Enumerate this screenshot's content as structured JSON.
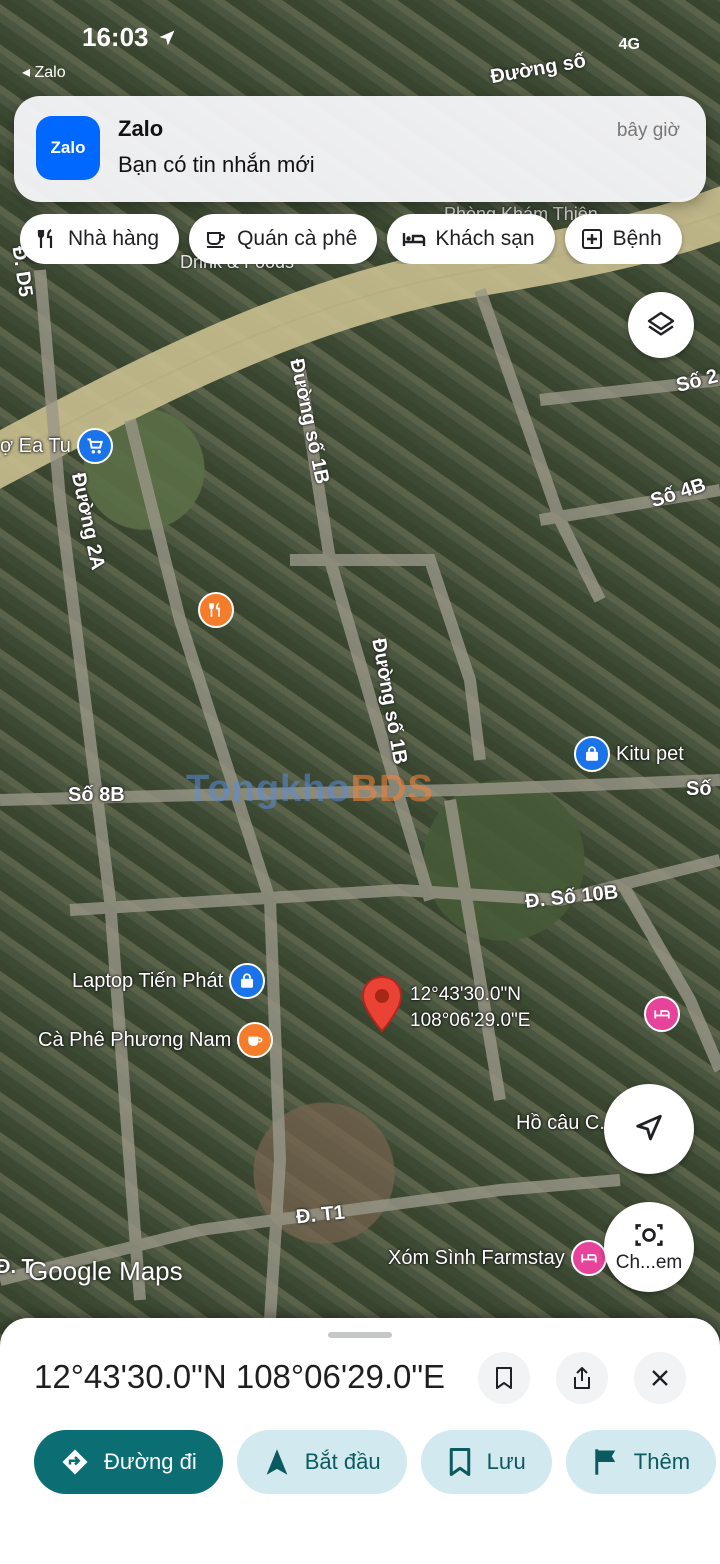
{
  "status_bar": {
    "time": "16:03",
    "back_app": "◂ Zalo",
    "network": "4G"
  },
  "notification": {
    "app_icon_text": "Zalo",
    "app_name": "Zalo",
    "time": "bây giờ",
    "message": "Bạn có tin nhắn mới"
  },
  "chips": [
    {
      "label": "Nhà hàng",
      "icon": "restaurant-icon"
    },
    {
      "label": "Quán cà phê",
      "icon": "coffee-icon"
    },
    {
      "label": "Khách sạn",
      "icon": "hotel-icon"
    },
    {
      "label": "Bệnh",
      "icon": "hospital-icon"
    }
  ],
  "map": {
    "road_labels": [
      "Đường số 1B",
      "Đường số 1B",
      "Đường 2A",
      "Số 8B",
      "Đ. Số 10B",
      "Số 4B",
      "Số 2",
      "Đ. T1",
      "Đ. D5",
      "Đường số",
      "Số",
      "Đ. T"
    ],
    "faint_labels": [
      "Drink & Foods",
      "Phòng Khám Thiện"
    ],
    "pois": [
      {
        "label": "ợ Ea Tu",
        "icon": "shopping-cart-icon",
        "color": "#1a73e8"
      },
      {
        "label": "Kitu pet",
        "icon": "shopping-bag-icon",
        "color": "#1a73e8"
      },
      {
        "label": "Laptop Tiến Phát",
        "icon": "shopping-bag-icon",
        "color": "#1a73e8"
      },
      {
        "label": "Cà Phê Phương Nam",
        "icon": "coffee-icon",
        "color": "#f57c2b"
      },
      {
        "label": "Hồ câu C...ến",
        "icon": "pin-icon",
        "color": "#1a73e8"
      },
      {
        "label": "Xóm Sình Farmstay",
        "icon": "hotel-icon",
        "color": "#e8439a"
      },
      {
        "label": "",
        "icon": "restaurant-icon",
        "color": "#f57c2b"
      },
      {
        "label": "",
        "icon": "hotel-icon",
        "color": "#e8439a"
      }
    ],
    "pin_coords": {
      "lat": "12°43'30.0\"N",
      "lng": "108°06'29.0\"E"
    },
    "watermark": {
      "part1": "Tongkho",
      "part2": "BDS"
    },
    "google_logo": "Google Maps"
  },
  "fabs": {
    "lens_label": "Ch...em"
  },
  "sheet": {
    "title": "12°43'30.0\"N 108°06'29.0\"E",
    "actions": [
      {
        "label": "Đường đi",
        "icon": "directions-icon"
      },
      {
        "label": "Bắt đầu",
        "icon": "navigation-arrow-icon"
      },
      {
        "label": "Lưu",
        "icon": "bookmark-icon"
      },
      {
        "label": "Thêm",
        "icon": "flag-icon"
      }
    ]
  }
}
